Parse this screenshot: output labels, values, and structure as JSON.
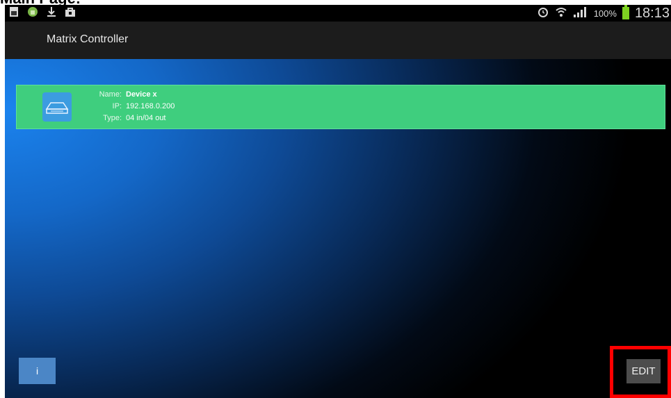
{
  "caption": "Main Page:",
  "status_bar": {
    "battery_percent": "100%",
    "time": "18:13",
    "icons": [
      "sim-card-icon",
      "android-icon",
      "download-icon",
      "shopping-bag-icon",
      "alarm-icon",
      "wifi-icon",
      "signal-icon",
      "battery-icon"
    ]
  },
  "app": {
    "title": "Matrix Controller"
  },
  "device": {
    "name_label": "Name:",
    "name_value": "Device x",
    "ip_label": "IP:",
    "ip_value": "192.168.0.200",
    "type_label": "Type:",
    "type_value": "04 in/04 out",
    "icon": "router-device-icon"
  },
  "buttons": {
    "info_label": "i",
    "edit_label": "EDIT"
  },
  "colors": {
    "device_row": "#3fce7e",
    "info_button": "#4b86c6",
    "edit_button": "#4c4c4c",
    "highlight": "#ff0000",
    "actionbar": "#1c1c1c"
  }
}
